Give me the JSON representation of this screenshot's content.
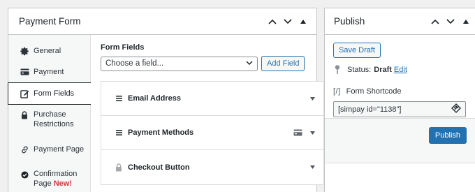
{
  "payment_form": {
    "title": "Payment Form",
    "tabs": [
      {
        "label": "General",
        "icon": "gear-icon"
      },
      {
        "label": "Payment",
        "icon": "card-icon"
      },
      {
        "label": "Form Fields",
        "icon": "edit-icon",
        "active": true
      },
      {
        "label_line1": "Purchase",
        "label_line2": "Restrictions",
        "icon": "lock-icon"
      },
      {
        "label": "Payment Page",
        "icon": "link-icon"
      },
      {
        "label_line1": "Confirmation",
        "label_line2": "Page",
        "badge": "New!",
        "icon": "check-circle-icon"
      }
    ],
    "form_fields_label": "Form Fields",
    "select_placeholder": "Choose a field...",
    "add_field_label": "Add Field",
    "fields": [
      {
        "name": "Email Address",
        "icon": "drag-handle-icon"
      },
      {
        "name": "Payment Methods",
        "icon": "drag-handle-icon",
        "extra_icon": "card-icon"
      },
      {
        "name": "Checkout Button",
        "icon": "lock-icon"
      }
    ]
  },
  "publish": {
    "title": "Publish",
    "save_draft_label": "Save Draft",
    "status_label": "Status:",
    "status_value": "Draft",
    "edit_label": "Edit",
    "shortcode_icon": "[/]",
    "shortcode_label": "Form Shortcode",
    "shortcode_value": "[simpay id=\"1138\"]",
    "publish_label": "Publish"
  },
  "colors": {
    "accent": "#2271b1",
    "badge": "#d63638",
    "border": "#c3c4c7",
    "background": "#f0f0f1"
  }
}
